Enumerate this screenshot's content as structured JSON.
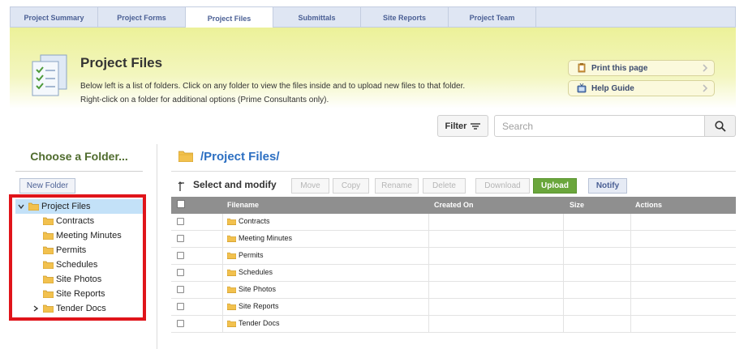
{
  "tabs": [
    {
      "label": "Project Summary"
    },
    {
      "label": "Project Forms"
    },
    {
      "label": "Project Files"
    },
    {
      "label": "Submittals"
    },
    {
      "label": "Site Reports"
    },
    {
      "label": "Project Team"
    }
  ],
  "active_tab": "Project Files",
  "header": {
    "title": "Project Files",
    "desc_line1": "Below left is a list of folders. Click on any folder to view the files inside and to upload new files to that folder.",
    "desc_line2": "Right-click on a folder for additional options (Prime Consultants only).",
    "print_label": "Print this page",
    "help_label": "Help Guide"
  },
  "filter": {
    "label": "Filter"
  },
  "search": {
    "placeholder": "Search"
  },
  "sidebar": {
    "title": "Choose a Folder...",
    "new_folder_label": "New Folder",
    "root": "Project Files",
    "folders": [
      "Contracts",
      "Meeting Minutes",
      "Permits",
      "Schedules",
      "Site Photos",
      "Site Reports",
      "Tender Docs"
    ]
  },
  "main": {
    "path": "/Project Files/",
    "select_label": "Select and modify",
    "actions": {
      "move": "Move",
      "copy": "Copy",
      "rename": "Rename",
      "delete": "Delete",
      "download": "Download",
      "upload": "Upload",
      "notify": "Notify"
    },
    "columns": {
      "filename": "Filename",
      "created_on": "Created On",
      "size": "Size",
      "actions": "Actions"
    },
    "rows": [
      "Contracts",
      "Meeting Minutes",
      "Permits",
      "Schedules",
      "Site Photos",
      "Site Reports",
      "Tender Docs"
    ]
  },
  "colors": {
    "accent": "#2c6fc2",
    "upload": "#6aa63c",
    "highlight_border": "#e0141a",
    "tree_selected": "#c3e1f8"
  }
}
